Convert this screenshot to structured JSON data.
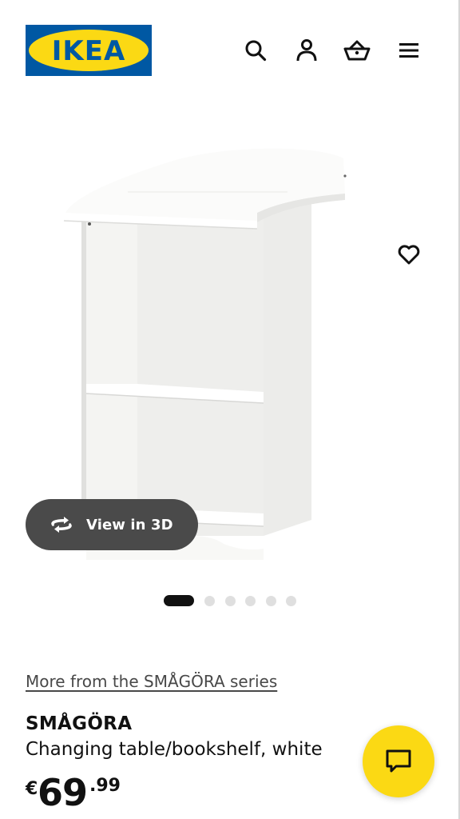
{
  "header": {
    "logo_text": "IKEA",
    "icons": [
      "search-icon",
      "user-icon",
      "basket-icon",
      "menu-icon"
    ]
  },
  "gallery": {
    "view3d_label": "View in 3D",
    "total_images": 6,
    "active_image": 1
  },
  "product": {
    "series_link": "More from the SMÅGÖRA series",
    "name": "SMÅGÖRA",
    "description": "Changing table/bookshelf, white",
    "price": {
      "currency": "€",
      "integer": "69",
      "decimal": ".99"
    }
  },
  "colors": {
    "brand_blue": "#0058a3",
    "brand_yellow": "#fbd914",
    "view3d_bg": "#4a4a4a",
    "text": "#111111"
  }
}
